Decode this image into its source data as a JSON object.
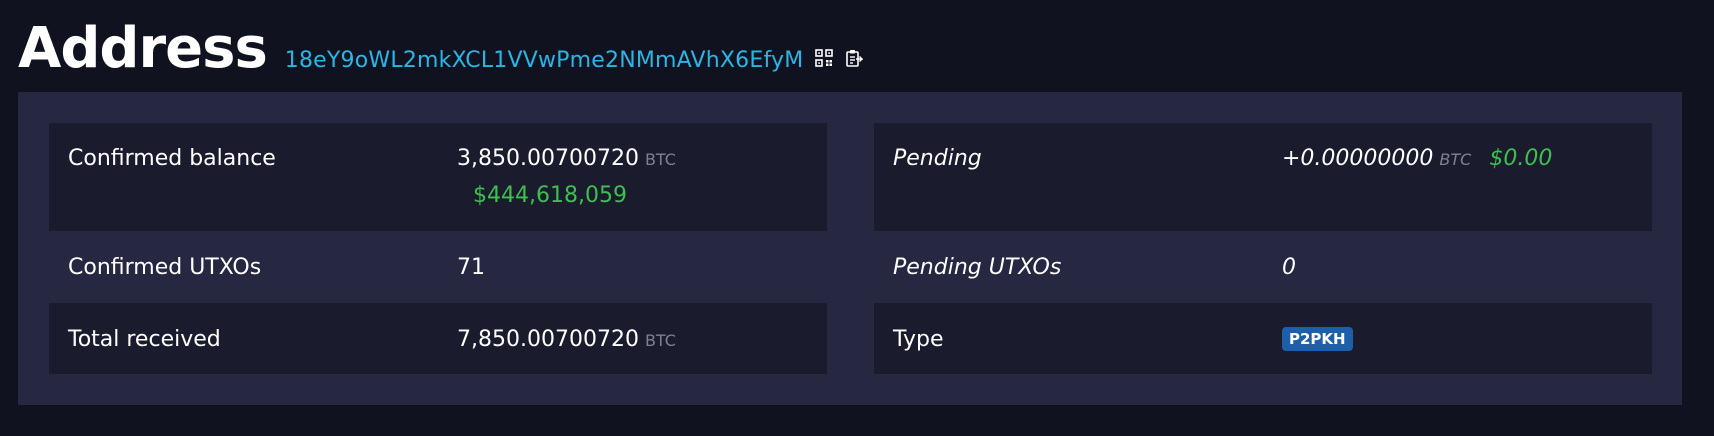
{
  "header": {
    "title": "Address",
    "address": "18eY9oWL2mkXCL1VVwPme2NMmAVhX6EfyM",
    "qr_icon": "qr-code-icon",
    "copy_icon": "clipboard-icon"
  },
  "details": {
    "confirmed_balance": {
      "label": "Confirmed balance",
      "value": "3,850.00700720",
      "unit": "BTC",
      "fiat": "$444,618,059"
    },
    "pending": {
      "label": "Pending",
      "value": "+0.00000000",
      "unit": "BTC",
      "fiat": "$0.00"
    },
    "confirmed_utxos": {
      "label": "Confirmed UTXOs",
      "value": "71"
    },
    "pending_utxos": {
      "label": "Pending UTXOs",
      "value": "0"
    },
    "total_received": {
      "label": "Total received",
      "value": "7,850.00700720",
      "unit": "BTC"
    },
    "type": {
      "label": "Type",
      "value": "P2PKH"
    }
  },
  "colors": {
    "background": "#10131f",
    "panel": "#252840",
    "cell": "#1a1c2e",
    "address_link": "#29b6e6",
    "fiat_green": "#3fbf4f",
    "badge_blue": "#1d5fa8",
    "unit_gray": "#7d8194"
  }
}
